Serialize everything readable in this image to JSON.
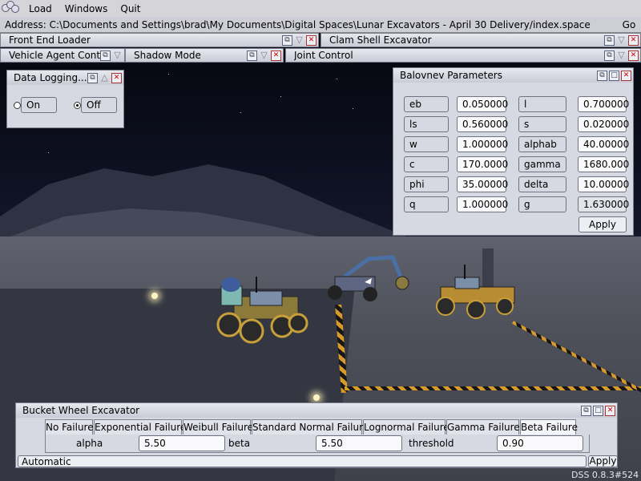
{
  "menu": {
    "items": [
      "Load",
      "Windows",
      "Quit"
    ]
  },
  "address": {
    "label": "Address: ",
    "value": "C:\\Documents and Settings\\brad\\My Documents\\Digital Spaces\\Lunar Excavators - April 30 Delivery/index.space",
    "go": "Go"
  },
  "tabs": {
    "front_end_loader": "Front End Loader",
    "clam_shell": "Clam Shell Excavator",
    "vehicle_agent": "Vehicle Agent Controls",
    "shadow_mode": "Shadow Mode",
    "joint_control": "Joint Control"
  },
  "data_logging": {
    "title": "Data Logging...",
    "on_label": "On",
    "off_label": "Off",
    "selected": "Off"
  },
  "balovnev": {
    "title": "Balovnev Parameters",
    "left": [
      {
        "name": "eb",
        "value": "0.050000"
      },
      {
        "name": "ls",
        "value": "0.560000"
      },
      {
        "name": "w",
        "value": "1.000000"
      },
      {
        "name": "c",
        "value": "170.0000"
      },
      {
        "name": "phi",
        "value": "35.00000"
      },
      {
        "name": "q",
        "value": "1.000000"
      }
    ],
    "right": [
      {
        "name": "l",
        "value": "0.700000"
      },
      {
        "name": "s",
        "value": "0.020000"
      },
      {
        "name": "alphab",
        "value": "40.00000"
      },
      {
        "name": "gamma",
        "value": "1680.000"
      },
      {
        "name": "delta",
        "value": "10.00000"
      },
      {
        "name": "g",
        "value": "1.630000"
      }
    ],
    "apply": "Apply"
  },
  "bucket_wheel": {
    "title": "Bucket Wheel Excavator",
    "tabs": [
      "No Failure",
      "Exponential Failure",
      "Weibull Failure",
      "Standard Normal Failure",
      "Lognormal Failure",
      "Gamma Failure",
      "Beta Failure"
    ],
    "active_tab": "Beta Failure",
    "params": [
      {
        "name": "alpha",
        "value": "5.50"
      },
      {
        "name": "beta",
        "value": "5.50"
      },
      {
        "name": "threshold",
        "value": "0.90"
      }
    ],
    "mode": "Automatic",
    "apply": "Apply"
  },
  "status": "DSS 0.8.3#524",
  "colors": {
    "window_bg": "#d6d8e2",
    "titlebar": "#c9cbd6",
    "close_red": "#cc0000"
  },
  "icons": {
    "window_buttons": [
      "restore-icon",
      "minimize-icon",
      "close-icon"
    ]
  }
}
